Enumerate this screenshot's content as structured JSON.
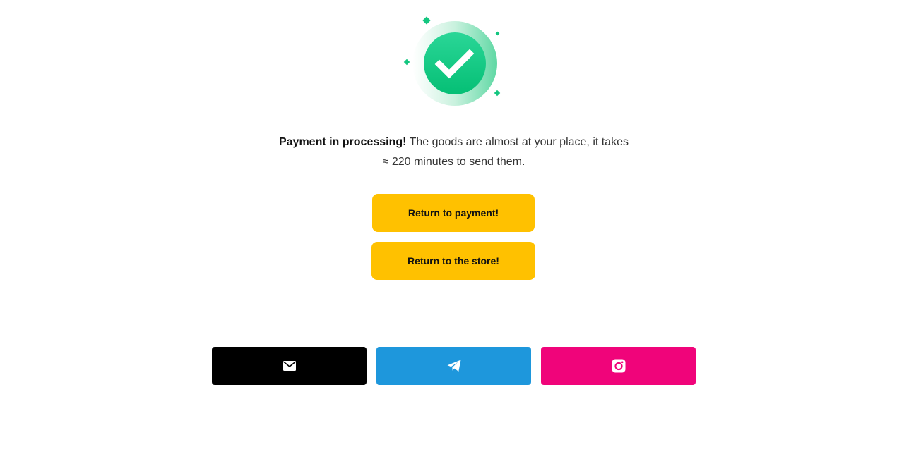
{
  "status": {
    "graphic_icon": "check-circle-icon",
    "lead": "Payment in processing!",
    "text_line1": "The goods are almost at your place, it takes",
    "text_line2": "≈ 220 minutes to send them."
  },
  "actions": {
    "return_payment_label": "Return to payment!",
    "return_store_label": "Return to the store!"
  },
  "social": [
    {
      "icon": "mail-icon",
      "color": "#000000"
    },
    {
      "icon": "telegram-icon",
      "color": "#1e97dc"
    },
    {
      "icon": "instagram-icon",
      "color": "#f0047a"
    }
  ],
  "colors": {
    "accent_button": "#ffc100",
    "success_green": "#14c680"
  }
}
